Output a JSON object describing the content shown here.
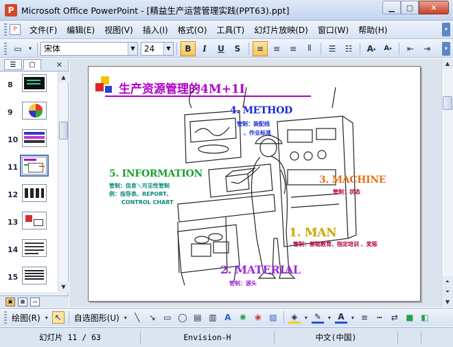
{
  "window": {
    "title": "Microsoft Office PowerPoint - [精益生产运营管理实践(PPT63).ppt]",
    "app_icon": "powerpoint-icon",
    "buttons": [
      "minimize",
      "maximize",
      "close"
    ]
  },
  "menubar": {
    "items": [
      {
        "label": "文件(F)"
      },
      {
        "label": "编辑(E)"
      },
      {
        "label": "视图(V)"
      },
      {
        "label": "插入(I)"
      },
      {
        "label": "格式(O)"
      },
      {
        "label": "工具(T)"
      },
      {
        "label": "幻灯片放映(D)"
      },
      {
        "label": "窗口(W)"
      },
      {
        "label": "帮助(H)"
      }
    ]
  },
  "toolbar": {
    "font_name": "宋体",
    "font_size": "24",
    "bold": "B",
    "italic": "I",
    "underline": "U",
    "shadow": "S"
  },
  "slides_pane": {
    "thumbnails": [
      {
        "number": "8"
      },
      {
        "number": "9"
      },
      {
        "number": "10"
      },
      {
        "number": "11",
        "selected": true
      },
      {
        "number": "12"
      },
      {
        "number": "13"
      },
      {
        "number": "14"
      },
      {
        "number": "15"
      }
    ]
  },
  "slide": {
    "title": "生产资源管理的4M+1I",
    "method": {
      "label": "4. METHOD",
      "line1": "管制：装配线",
      "line2": "、作业标准"
    },
    "machine": {
      "label": "3. MACHINE",
      "line1": "管制：状态"
    },
    "information": {
      "label": "5. INFORMATION",
      "line1": "管制：信息＼可见性管制",
      "line2": "例：指导表、REPORT、",
      "line3": "CONTROL CHART"
    },
    "man": {
      "label": "1. MAN",
      "line1": "管制：基础教育、指定培训 、奖惩"
    },
    "material": {
      "label": "2. MATERIAL",
      "line1": "管制：源头"
    },
    "colors": {
      "title": "#b000c8",
      "method": "#1a2ad6",
      "machine": "#e8701a",
      "information": "#1aa12a",
      "man": "#c8a800",
      "material": "#9b2ad6"
    }
  },
  "drawbar": {
    "draw_label": "绘图(R)",
    "autoshape_label": "自选图形(U)"
  },
  "statusbar": {
    "slide_info": "幻灯片 11 / 63",
    "design": "Envision-H",
    "language": "中文(中国)"
  }
}
